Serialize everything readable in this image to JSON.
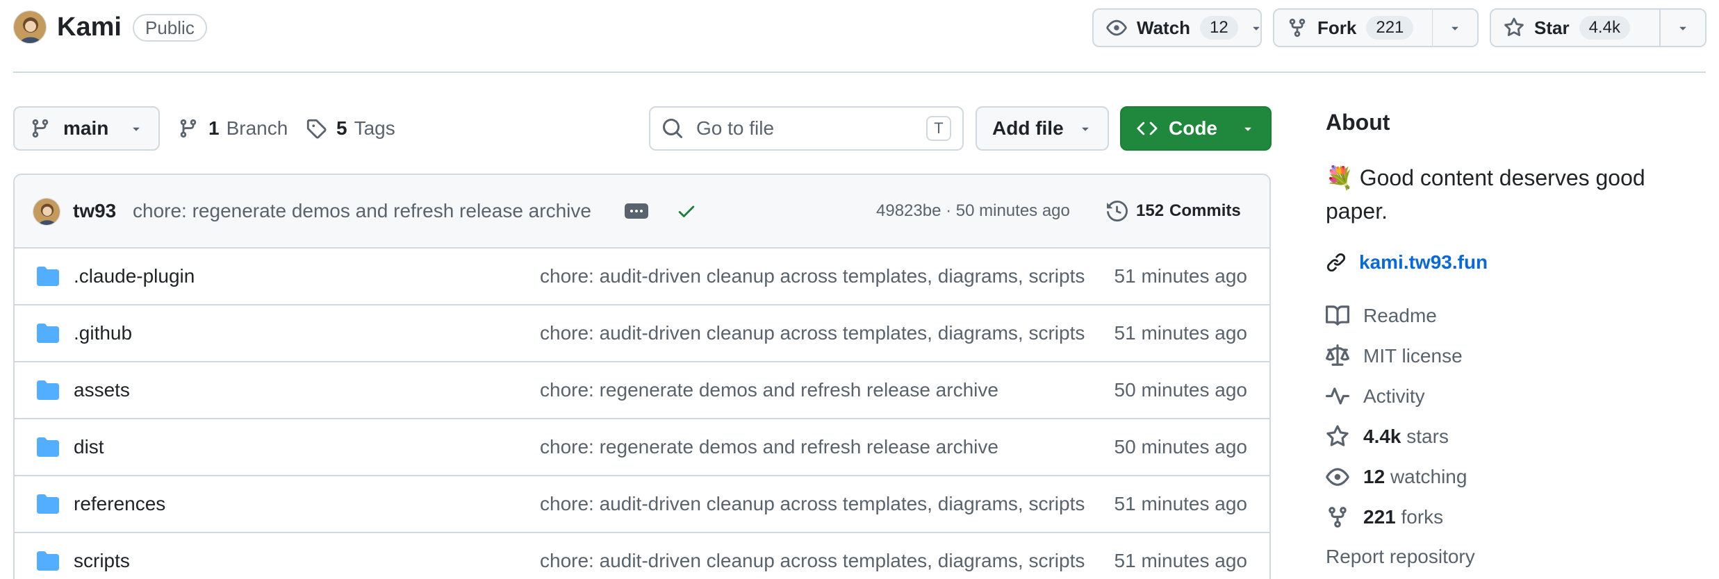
{
  "repo": {
    "name": "Kami",
    "visibility": "Public",
    "watch_label": "Watch",
    "watch_count": "12",
    "fork_label": "Fork",
    "fork_count": "221",
    "star_label": "Star",
    "star_count": "4.4k"
  },
  "toolbar": {
    "branch": "main",
    "branch_count": "1",
    "branch_label": "Branch",
    "tag_count": "5",
    "tag_label": "Tags",
    "search_placeholder": "Go to file",
    "search_shortcut": "T",
    "add_file_label": "Add file",
    "code_label": "Code"
  },
  "commit": {
    "author": "tw93",
    "message": "chore: regenerate demos and refresh release archive",
    "hash_time": "49823be · 50 minutes ago",
    "commits_count": "152",
    "commits_label": "Commits"
  },
  "files": [
    {
      "name": ".claude-plugin",
      "message": "chore: audit-driven cleanup across templates, diagrams, scripts",
      "time": "51 minutes ago"
    },
    {
      "name": ".github",
      "message": "chore: audit-driven cleanup across templates, diagrams, scripts",
      "time": "51 minutes ago"
    },
    {
      "name": "assets",
      "message": "chore: regenerate demos and refresh release archive",
      "time": "50 minutes ago"
    },
    {
      "name": "dist",
      "message": "chore: regenerate demos and refresh release archive",
      "time": "50 minutes ago"
    },
    {
      "name": "references",
      "message": "chore: audit-driven cleanup across templates, diagrams, scripts",
      "time": "51 minutes ago"
    },
    {
      "name": "scripts",
      "message": "chore: audit-driven cleanup across templates, diagrams, scripts",
      "time": "51 minutes ago"
    }
  ],
  "about": {
    "title": "About",
    "description": "💐 Good content deserves good paper.",
    "website": "kami.tw93.fun",
    "readme": "Readme",
    "license": "MIT license",
    "activity": "Activity",
    "stars_count": "4.4k",
    "stars_label": "stars",
    "watching_count": "12",
    "watching_label": "watching",
    "forks_count": "221",
    "forks_label": "forks",
    "report": "Report repository"
  },
  "colors": {
    "accent_green": "#1f883d",
    "link_blue": "#0969da",
    "border": "#d1d9e0",
    "folder": "#54aeff",
    "muted_text": "#59636e"
  }
}
